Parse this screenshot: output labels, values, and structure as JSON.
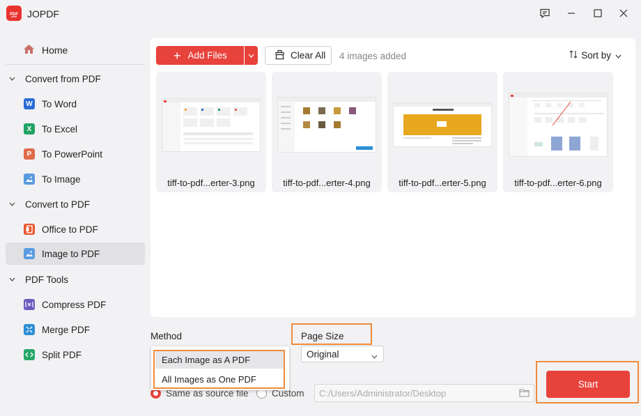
{
  "app": {
    "title": "JOPDF",
    "accent": "#e8423c",
    "highlight": "#f08a3b"
  },
  "window_controls": [
    "feedback-icon",
    "minimize-icon",
    "maximize-icon",
    "close-icon"
  ],
  "sidebar": {
    "home": "Home",
    "sections": [
      {
        "label": "Convert from PDF",
        "items": [
          {
            "label": "To Word",
            "icon": "word-icon",
            "color": "#2b6cd4"
          },
          {
            "label": "To Excel",
            "icon": "excel-icon",
            "color": "#21a366"
          },
          {
            "label": "To PowerPoint",
            "icon": "powerpoint-icon",
            "color": "#e06a4a"
          },
          {
            "label": "To Image",
            "icon": "image-icon",
            "color": "#5a9be0"
          }
        ]
      },
      {
        "label": "Convert to PDF",
        "items": [
          {
            "label": "Office to PDF",
            "icon": "office-icon",
            "color": "#e8572c"
          },
          {
            "label": "Image to PDF",
            "icon": "image-icon",
            "color": "#5a9be0",
            "active": true
          }
        ]
      },
      {
        "label": "PDF Tools",
        "items": [
          {
            "label": "Compress PDF",
            "icon": "compress-icon",
            "color": "#6e5bbf"
          },
          {
            "label": "Merge PDF",
            "icon": "merge-icon",
            "color": "#2e8fd6"
          },
          {
            "label": "Split PDF",
            "icon": "split-icon",
            "color": "#27a86a"
          }
        ]
      }
    ]
  },
  "toolbar": {
    "add_files": "Add Files",
    "clear_all": "Clear All",
    "count_text": "4 images added",
    "sort_by": "Sort by"
  },
  "files": [
    {
      "name": "tiff-to-pdf...erter-3.png"
    },
    {
      "name": "tiff-to-pdf...erter-4.png"
    },
    {
      "name": "tiff-to-pdf...erter-5.png"
    },
    {
      "name": "tiff-to-pdf...erter-6.png"
    }
  ],
  "options": {
    "method_label": "Method",
    "method_options": [
      "Each Image as A PDF",
      "All Images as One PDF"
    ],
    "method_selected": "Each Image as A PDF",
    "page_size_label": "Page Size",
    "page_size_value": "Original",
    "output_options": [
      "Same as source file",
      "Custom"
    ],
    "output_selected": "Same as source file",
    "output_path": "C:/Users/Administrator/Desktop",
    "start": "Start"
  }
}
